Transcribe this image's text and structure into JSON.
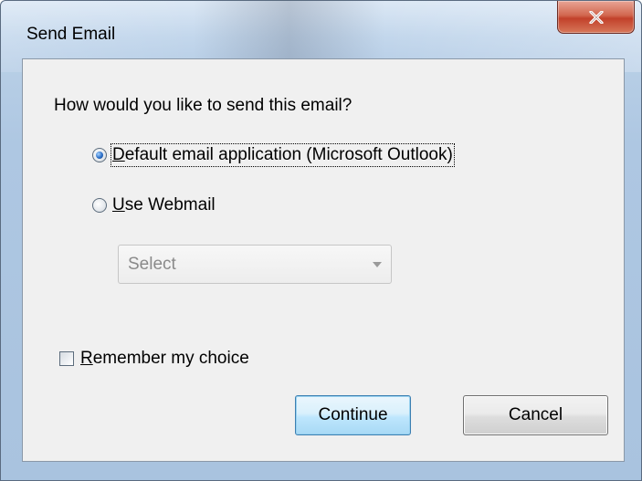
{
  "window": {
    "title": "Send Email"
  },
  "dialog": {
    "question": "How would you like to send this email?",
    "options": [
      {
        "label": "Default email application (Microsoft Outlook)",
        "underline_char": "D",
        "rest": "efault email application (Microsoft Outlook)",
        "selected": true
      },
      {
        "label": "Use Webmail",
        "underline_char": "U",
        "rest": "se Webmail",
        "selected": false
      }
    ],
    "webmail_select": {
      "value": "Select",
      "enabled": false
    },
    "remember": {
      "underline_char": "R",
      "rest": "emember my choice",
      "checked": false
    },
    "buttons": {
      "continue": "Continue",
      "cancel": "Cancel"
    }
  },
  "icons": {
    "close": "close-icon",
    "dropdown": "chevron-down-icon"
  },
  "colors": {
    "close_button": "#c2412a",
    "default_button_border": "#3c7fb1",
    "radio_dot": "#2b6fc8"
  }
}
